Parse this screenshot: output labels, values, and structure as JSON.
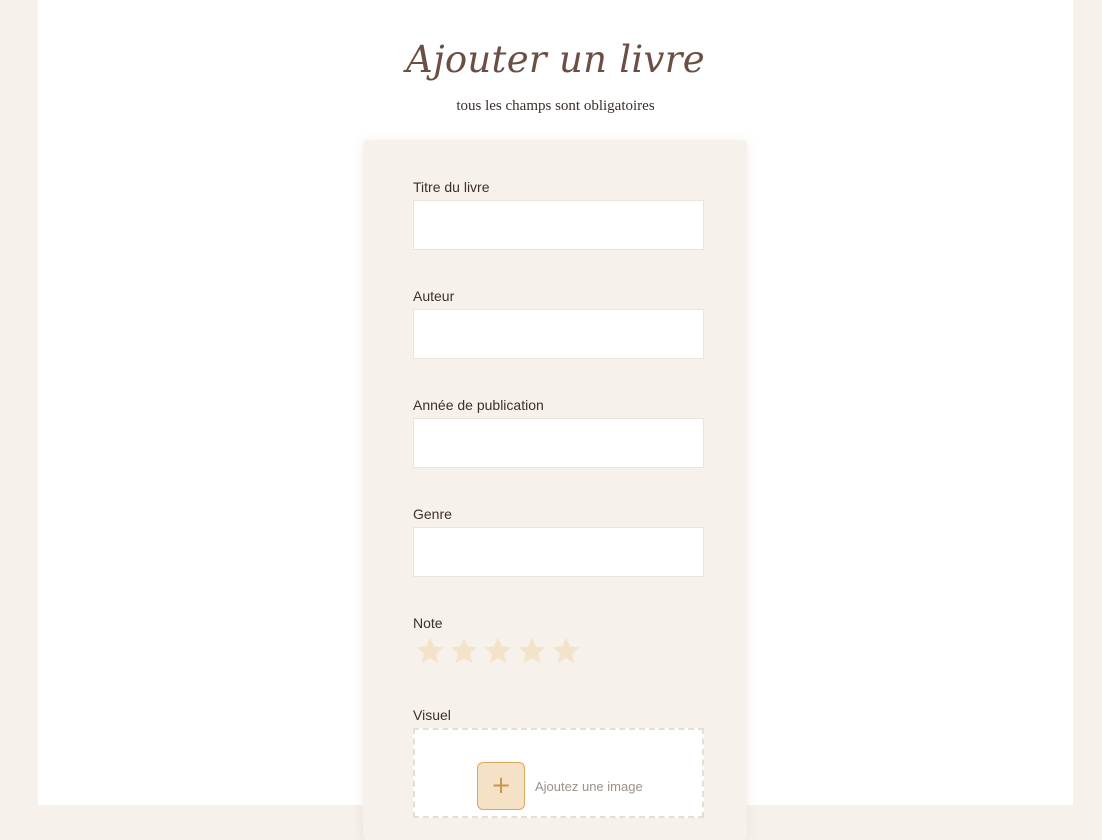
{
  "header": {
    "title": "Ajouter un livre",
    "subtitle": "tous les champs sont obligatoires"
  },
  "form": {
    "fields": [
      {
        "label": "Titre du livre",
        "value": ""
      },
      {
        "label": "Auteur",
        "value": ""
      },
      {
        "label": "Année de publication",
        "value": ""
      },
      {
        "label": "Genre",
        "value": ""
      }
    ],
    "rating": {
      "label": "Note",
      "value": 0,
      "max": 5,
      "star_icon": "star-icon",
      "star_color": "#f3e3c8"
    },
    "visual": {
      "label": "Visuel",
      "add_icon": "plus-icon",
      "add_text": "Ajoutez une image"
    }
  },
  "colors": {
    "title": "#6b4f44",
    "card_background": "#f7f1eb",
    "accent": "#d9a85c",
    "page_background": "#f6f1eb"
  }
}
